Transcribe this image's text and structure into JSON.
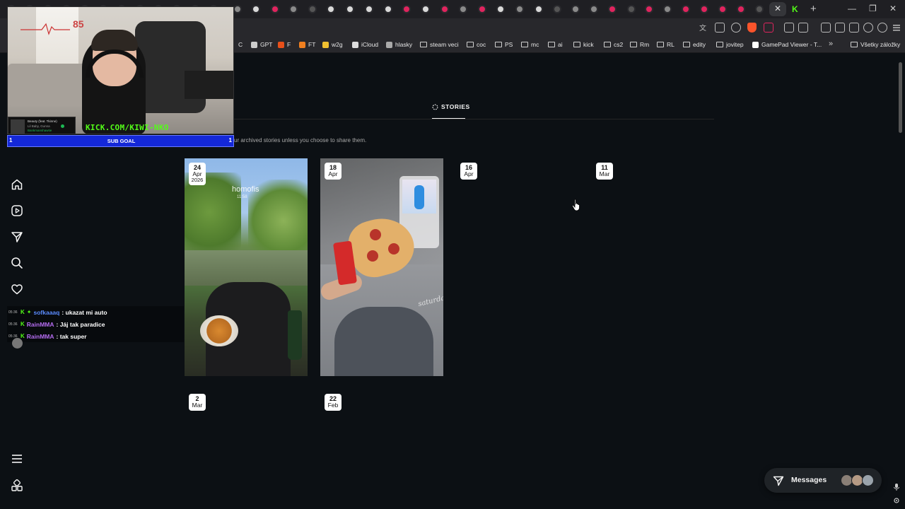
{
  "browser": {
    "tab_close": "✕",
    "tab_plus": "+",
    "window_controls": [
      "—",
      "❐",
      "✕"
    ],
    "bookmarks": [
      {
        "label": "C",
        "kind": "text"
      },
      {
        "label": "GPT",
        "kind": "fav",
        "color": "#cccccc"
      },
      {
        "label": "F",
        "kind": "fav",
        "color": "#e8501a"
      },
      {
        "label": "FT",
        "kind": "fav",
        "color": "#f08020"
      },
      {
        "label": "w2g",
        "kind": "fav",
        "color": "#f0c030"
      },
      {
        "label": "iCloud",
        "kind": "fav",
        "color": "#dddddd"
      },
      {
        "label": "hlasky",
        "kind": "fav",
        "color": "#aaaaaa"
      },
      {
        "label": "steam veci",
        "kind": "folder"
      },
      {
        "label": "coc",
        "kind": "folder"
      },
      {
        "label": "PS",
        "kind": "folder"
      },
      {
        "label": "mc",
        "kind": "folder"
      },
      {
        "label": "ai",
        "kind": "folder"
      },
      {
        "label": "kick",
        "kind": "folder"
      },
      {
        "label": "cs2",
        "kind": "folder"
      },
      {
        "label": "Rm",
        "kind": "folder"
      },
      {
        "label": "RL",
        "kind": "folder"
      },
      {
        "label": "edity",
        "kind": "folder"
      },
      {
        "label": "jovitep",
        "kind": "folder"
      },
      {
        "label": "GamePad Viewer - T...",
        "kind": "fav",
        "color": "#ffffff"
      }
    ],
    "bookmarks_more": "»",
    "all_bookmarks": "Všetky záložky"
  },
  "overlay": {
    "heart_rate": "85",
    "now_playing": {
      "title": "Beauty (feat. Tkinne)",
      "artist": "Lil Baby, Gunna",
      "album": "Bankmanshawtie"
    },
    "kick_url": "KICK.COM/KIWI-NKO",
    "sub_goal": {
      "label": "SUB GOAL",
      "left": "1",
      "right": "1"
    },
    "chat": [
      {
        "time": "05:36",
        "user": "sofkaaaq",
        "user_color": "#5b8cff",
        "message": ": ukazat mi auto"
      },
      {
        "time": "05:36",
        "user": "RainMMA",
        "user_color": "#b46cf0",
        "message": ": Jáj tak paradice"
      },
      {
        "time": "05:36",
        "user": "RainMMA",
        "user_color": "#b46cf0",
        "message": ": tak super"
      }
    ]
  },
  "main": {
    "tab_label": "STORIES",
    "archive_note": "ur archived stories unless you choose to share them.",
    "stories": [
      {
        "day": "24",
        "month": "Apr",
        "year": "2026",
        "overlay_place": "homofis",
        "overlay_time": "11:58"
      },
      {
        "day": "18",
        "month": "Apr",
        "year": "",
        "overlay_text": "saturday"
      },
      {
        "day": "16",
        "month": "Apr",
        "year": ""
      },
      {
        "day": "11",
        "month": "Mar",
        "year": ""
      },
      {
        "day": "2",
        "month": "Mar",
        "year": ""
      },
      {
        "day": "22",
        "month": "Feb",
        "year": ""
      }
    ]
  },
  "messages": {
    "label": "Messages"
  },
  "colors": {
    "background": "#0c1014",
    "accent_kick": "#53fc18",
    "subgoal_bg": "#1428d8"
  },
  "sidebar_icons": [
    "home-icon",
    "reels-icon",
    "direct-icon",
    "search-icon",
    "notifications-icon",
    "more-menu-icon",
    "also-from-meta-icon"
  ]
}
